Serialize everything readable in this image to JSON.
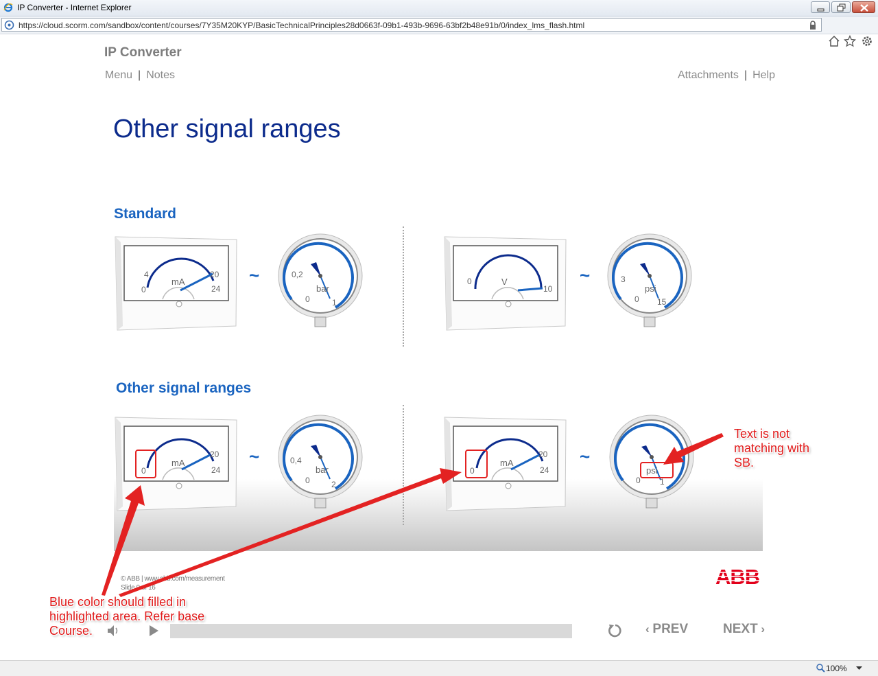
{
  "browser": {
    "window_title": "IP Converter - Internet Explorer",
    "url": "https://cloud.scorm.com/sandbox/content/courses/7Y35M20KYP/BasicTechnicalPrinciples28d0663f-09b1-493b-9696-63bf2b48e91b/0/index_lms_flash.html",
    "zoom": "100%"
  },
  "course": {
    "title": "IP Converter",
    "menu_label": "Menu",
    "notes_label": "Notes",
    "attachments_label": "Attachments",
    "help_label": "Help",
    "separator": "|"
  },
  "slide": {
    "title": "Other signal ranges",
    "section_standard": "Standard",
    "section_other": "Other signal ranges",
    "tilde": "~",
    "gauges": {
      "std_panel_ma": {
        "unit": "mA",
        "labels": [
          "0",
          "4",
          "20",
          "24"
        ]
      },
      "std_round_bar": {
        "unit": "bar",
        "labels": [
          "0,2",
          "0",
          "1"
        ]
      },
      "std_panel_v": {
        "unit": "V",
        "labels": [
          "0",
          "10"
        ]
      },
      "std_round_psi": {
        "unit": "psi",
        "labels": [
          "3",
          "0",
          "15"
        ]
      },
      "oth_panel_ma_1": {
        "unit": "mA",
        "labels": [
          "0",
          "20",
          "24"
        ]
      },
      "oth_round_bar": {
        "unit": "bar",
        "labels": [
          "0,4",
          "0",
          "2"
        ]
      },
      "oth_panel_ma_2": {
        "unit": "mA",
        "labels": [
          "0",
          "20",
          "24"
        ]
      },
      "oth_round_psi": {
        "unit": "psi",
        "labels": [
          "0",
          "1"
        ]
      }
    },
    "footer_copyright": "© ABB | www.abb.com/measurement",
    "footer_slide": "Slide 9 of 16"
  },
  "brand": {
    "logo_text": "ABB",
    "logo_color": "#e2001a",
    "accent": "#1a64c0",
    "title_color": "#0c2b8c"
  },
  "player": {
    "prev_label": "PREV",
    "next_label": "NEXT",
    "progress": 0
  },
  "annotations": {
    "callout_right": [
      "Text is not",
      "matching with",
      "SB."
    ],
    "callout_left": [
      "Blue color should filled in",
      "highlighted area. Refer base",
      "Course."
    ],
    "color": "#e32222"
  }
}
